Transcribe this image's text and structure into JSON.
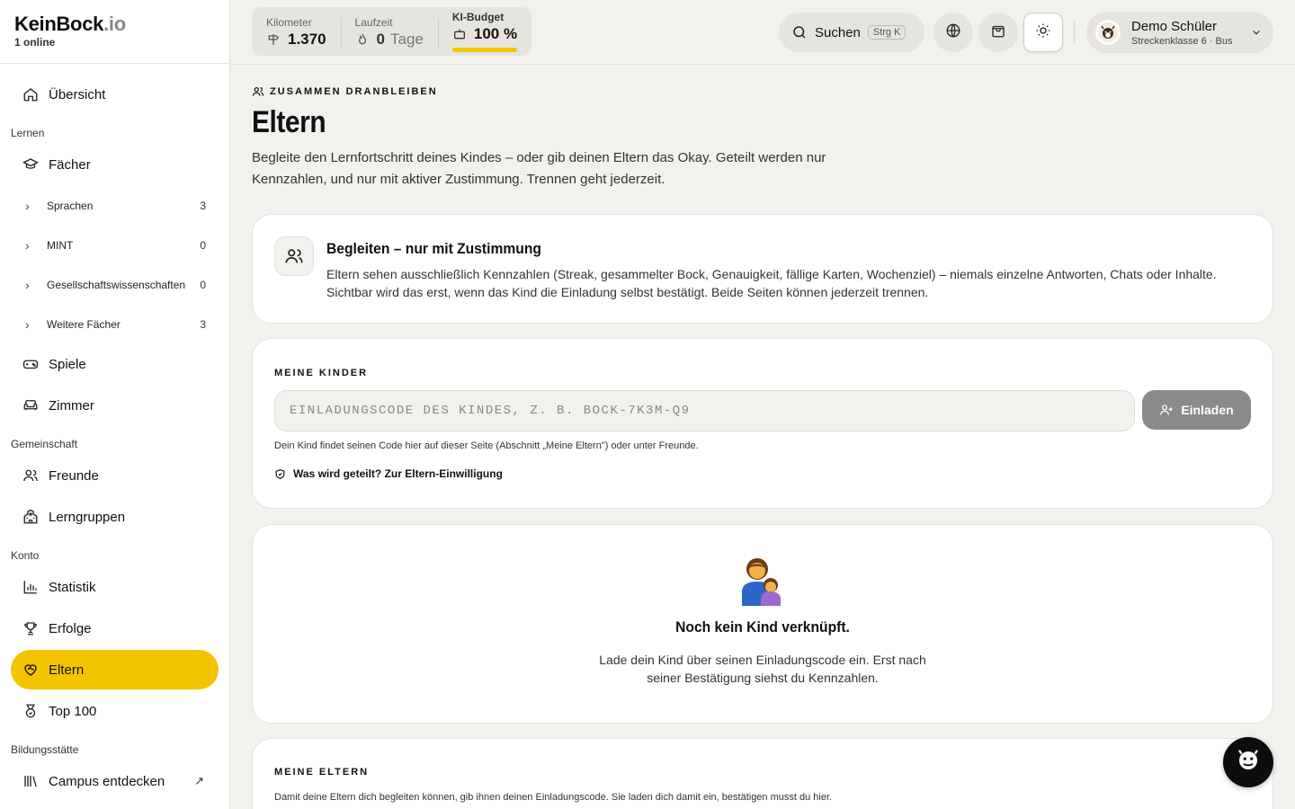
{
  "brand": {
    "name": "KeinBock",
    "tld": ".io",
    "online": "1  online"
  },
  "sidebar": {
    "overview": "Übersicht",
    "sections": {
      "learn": "Lernen",
      "community": "Gemeinschaft",
      "account": "Konto",
      "campus": "Bildungsstätte"
    },
    "subjects": "Fächer",
    "subject_groups": [
      {
        "label": "Sprachen",
        "count": "3"
      },
      {
        "label": "MINT",
        "count": "0"
      },
      {
        "label": "Gesellschaftswissenschaften",
        "count": "0"
      },
      {
        "label": "Weitere Fächer",
        "count": "3"
      }
    ],
    "games": "Spiele",
    "room": "Zimmer",
    "friends": "Freunde",
    "study_groups": "Lerngruppen",
    "stats": "Statistik",
    "achievements": "Erfolge",
    "parents": "Eltern",
    "top100": "Top 100",
    "campus_discover": "Campus entdecken",
    "ext_arrow": "↗"
  },
  "topbar": {
    "km_label": "Kilometer",
    "km_value": "1.370",
    "streak_label": "Laufzeit",
    "streak_value": "0",
    "streak_unit": "Tage",
    "budget_label": "KI-Budget",
    "budget_value": "100 %",
    "budget_fraction": 1.0,
    "search_label": "Suchen",
    "search_kbd": "Strg K",
    "user_name": "Demo Schüler",
    "user_sub": "Streckenklasse 6 · Bus"
  },
  "page": {
    "eyebrow": "ZUSAMMEN DRANBLEIBEN",
    "title": "Eltern",
    "intro": "Begleite den Lernfortschritt deines Kindes – oder gib deinen Eltern das Okay. Geteilt werden nur Kennzahlen, und nur mit aktiver Zustimmung. Trennen geht jederzeit."
  },
  "consent_card": {
    "title": "Begleiten – nur mit Zustimmung",
    "text": "Eltern sehen ausschließlich Kennzahlen (Streak, gesammelter Bock, Genauigkeit, fällige Karten, Wochenziel) – niemals einzelne Antworten, Chats oder Inhalte. Sichtbar wird das erst, wenn das Kind die Einladung selbst bestätigt. Beide Seiten können jederzeit trennen."
  },
  "kids_card": {
    "title": "MEINE KINDER",
    "placeholder": "EINLADUNGSCODE DES KINDES, Z. B. BOCK-7K3M-Q9",
    "invite_label": "Einladen",
    "hint": "Dein Kind findet seinen Code hier auf dieser Seite (Abschnitt „Meine Eltern\") oder unter Freunde.",
    "link": "Was wird geteilt? Zur Eltern-Einwilligung"
  },
  "empty_card": {
    "title": "Noch kein Kind verknüpft.",
    "text": "Lade dein Kind über seinen Einladungscode ein. Erst nach seiner Bestätigung siehst du Kennzahlen."
  },
  "parents_card": {
    "title": "MEINE ELTERN",
    "desc": "Damit deine Eltern dich begleiten können, gib ihnen deinen Einladungscode. Sie laden dich damit ein, bestätigen musst du hier."
  },
  "colors": {
    "accent": "#f5c400",
    "background": "#f2f1ee",
    "card": "#ffffff",
    "button_disabled": "#8a8a8a"
  }
}
